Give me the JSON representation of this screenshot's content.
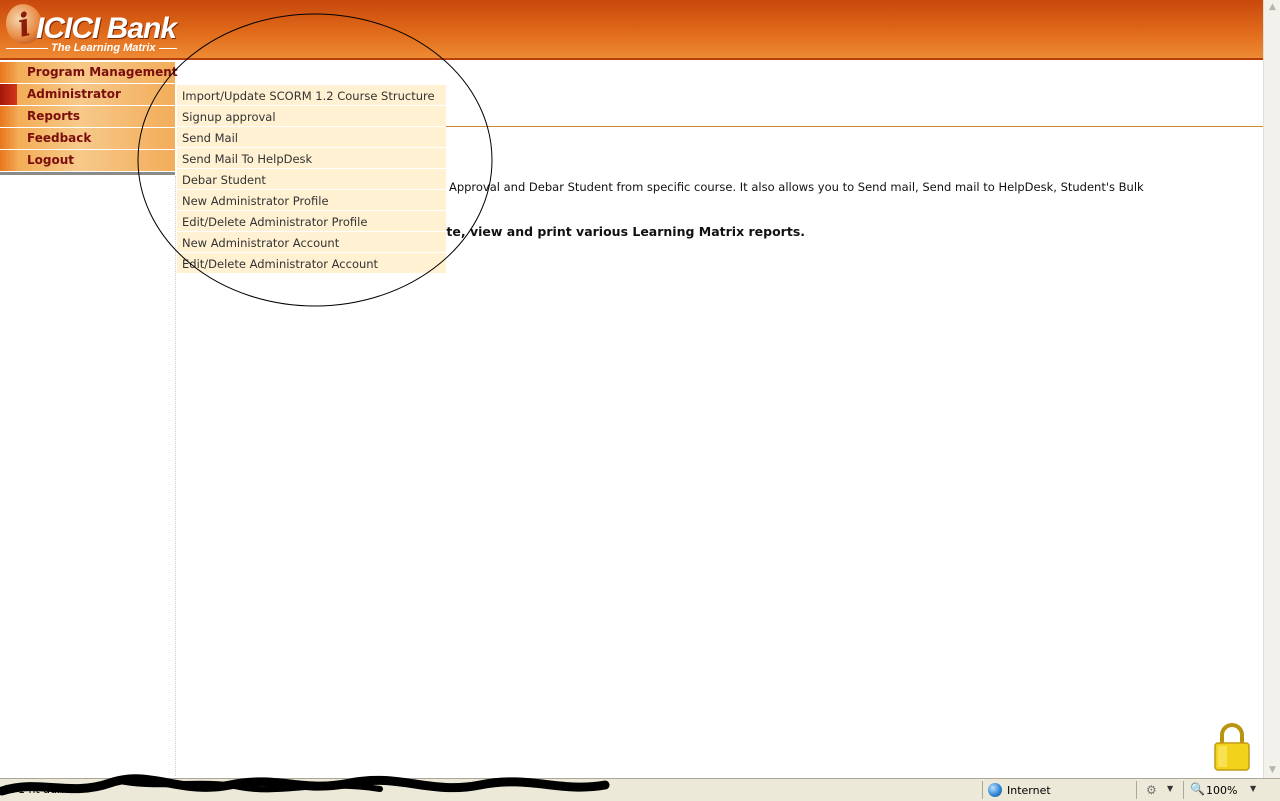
{
  "header": {
    "logo_text": "ICICI Bank",
    "logo_subtitle": "The Learning Matrix",
    "brand_color": "#e06a1a"
  },
  "nav": {
    "items": [
      {
        "label": "Program Management",
        "active": false
      },
      {
        "label": "Administrator",
        "active": true
      },
      {
        "label": "Reports",
        "active": false
      },
      {
        "label": "Feedback",
        "active": false
      },
      {
        "label": "Logout",
        "active": false
      }
    ]
  },
  "dropdown": {
    "items": [
      "Import/Update SCORM 1.2 Course Structure",
      "Signup approval",
      "Send Mail",
      "Send Mail To HelpDesk",
      "Debar Student",
      "New Administrator Profile",
      "Edit/Delete Administrator Profile",
      "New Administrator Account",
      "Edit/Delete Administrator Account"
    ]
  },
  "content": {
    "description_fragment": "p Approval and Debar Student from specific course. It also allows you to Send mail, Send mail to HelpDesk, Student's Bulk",
    "reports_fragment": "ate, view and print various Learning Matrix reports."
  },
  "statusbar": {
    "zone": "Internet",
    "zoom": "100%",
    "status_text": "2.  1  ht  admin"
  }
}
